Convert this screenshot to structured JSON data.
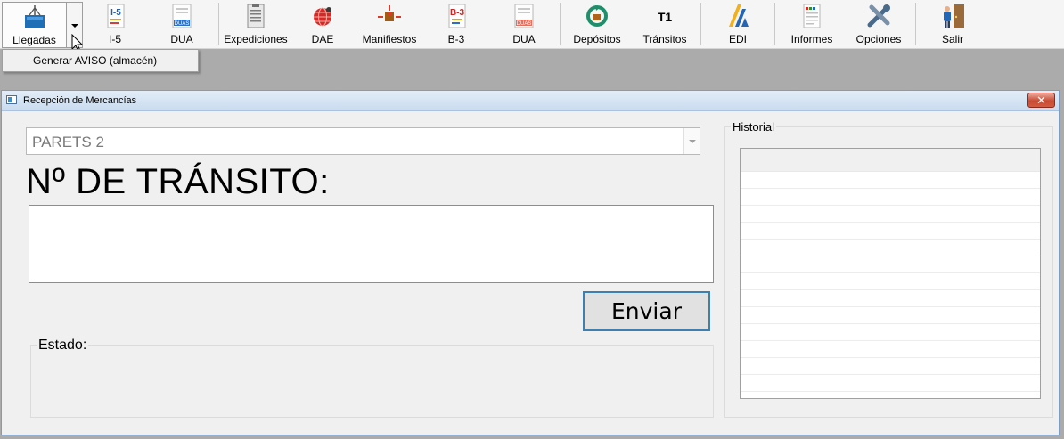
{
  "toolbar": {
    "items": [
      {
        "label": "Llegadas",
        "icon": "truck-box-icon"
      },
      {
        "label": "I-5",
        "icon": "i5-document-icon"
      },
      {
        "label": "DUA",
        "icon": "duas-document-icon"
      },
      {
        "label": "Expediciones",
        "icon": "clipboard-list-icon"
      },
      {
        "label": "DAE",
        "icon": "globe-icon"
      },
      {
        "label": "Manifiestos",
        "icon": "package-arrows-icon"
      },
      {
        "label": "B-3",
        "icon": "b3-document-icon"
      },
      {
        "label": "DUA",
        "icon": "duas-document-icon"
      },
      {
        "label": "Depósitos",
        "icon": "recycle-icon"
      },
      {
        "label": "Tránsitos",
        "icon": "t1-icon"
      },
      {
        "label": "EDI",
        "icon": "agencia-tributaria-logo-icon"
      },
      {
        "label": "Informes",
        "icon": "report-icon"
      },
      {
        "label": "Opciones",
        "icon": "tools-icon"
      },
      {
        "label": "Salir",
        "icon": "exit-door-icon"
      }
    ],
    "icon_texts": {
      "i5": "I-5",
      "duas": "DUAS",
      "b3": "B-3",
      "t1": "T1"
    }
  },
  "menu": {
    "items": [
      "Generar AVISO (almacén)"
    ]
  },
  "window": {
    "title": "Recepción de Mercancías",
    "combo_value": "PARETS 2",
    "heading": "Nº DE TRÁNSITO:",
    "transit_value": "",
    "send_label": "Enviar",
    "status_label": "Estado:",
    "history_label": "Historial"
  },
  "colors": {
    "accent_border": "#3c7fb1",
    "close_button": "#c94a33",
    "toolbar_bg": "#f5f5f5"
  }
}
